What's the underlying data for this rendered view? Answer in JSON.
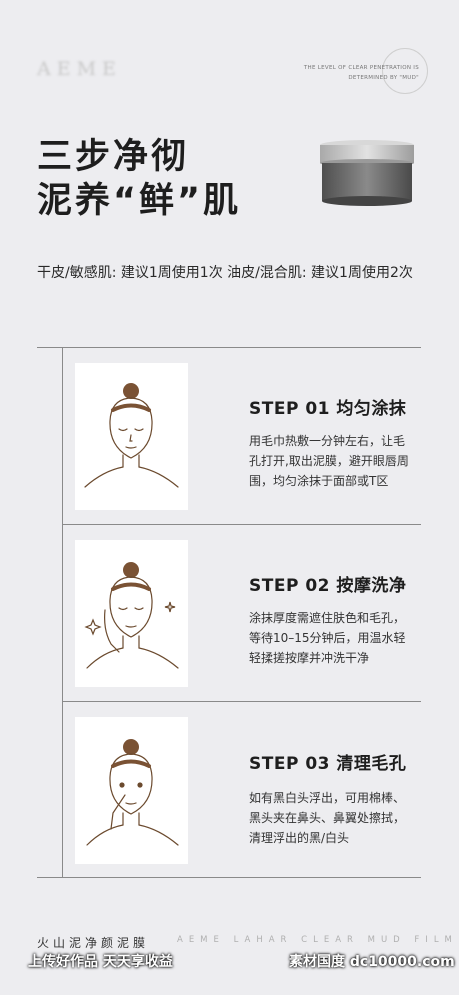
{
  "brand": "AEME",
  "tagline": [
    "THE LEVEL OF CLEAR PENETRATION IS",
    "DETERMINED BY \"MUD\""
  ],
  "headline": [
    "三步净彻",
    "泥养“鲜”肌"
  ],
  "frequency": "干皮/敏感肌: 建议1周使用1次 油皮/混合肌: 建议1周使用2次",
  "steps": [
    {
      "title": "STEP 01   均匀涂抹",
      "lines": [
        "用毛巾热敷一分钟左右，让毛",
        "孔打开,取出泥膜，避开眼唇周",
        "围，均匀涂抹于面部或T区"
      ]
    },
    {
      "title": "STEP 02   按摩洗净",
      "lines": [
        "涂抹厚度需遮住肤色和毛孔，",
        "等待10–15分钟后，用温水轻",
        "轻揉搓按摩并冲洗干净"
      ]
    },
    {
      "title": "STEP 03   清理毛孔",
      "lines": [
        "如有黑白头浮出，可用棉棒、",
        "黑头夹在鼻头、鼻翼处擦拭，",
        "清理浮出的黑/白头"
      ]
    }
  ],
  "footer": {
    "left": "火山泥净颜泥膜",
    "right": "AEME LAHAR CLEAR MUD FILM"
  },
  "watermark": {
    "left": "上传好作品 天天享收益",
    "right": "素材国度 dc10000.com"
  },
  "colors": {
    "background": "#ededf0",
    "jar_lid": "#bfbfbf",
    "jar_body": "#6b6b6b",
    "illustration_line": "#6b4a2e"
  }
}
